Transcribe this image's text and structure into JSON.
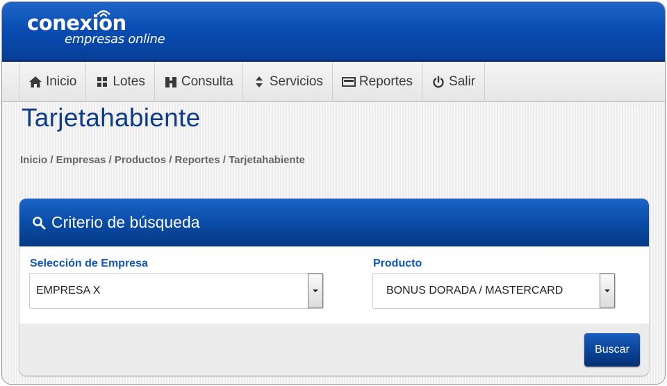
{
  "brand": {
    "name": "conexion",
    "tagline": "empresas online"
  },
  "nav": {
    "items": [
      {
        "label": "Inicio",
        "icon": "home-icon"
      },
      {
        "label": "Lotes",
        "icon": "lotes-icon"
      },
      {
        "label": "Consulta",
        "icon": "consulta-icon"
      },
      {
        "label": "Servicios",
        "icon": "servicios-icon"
      },
      {
        "label": "Reportes",
        "icon": "reportes-icon"
      },
      {
        "label": "Salir",
        "icon": "power-icon"
      }
    ]
  },
  "page": {
    "title": "Tarjetahabiente",
    "breadcrumb": "Inicio / Empresas / Productos / Reportes / Tarjetahabiente"
  },
  "search_panel": {
    "title": "Criterio de búsqueda",
    "icon": "search-icon",
    "empresa": {
      "label": "Selección de Empresa",
      "value": "EMPRESA X"
    },
    "producto": {
      "label": "Producto",
      "value": "BONUS DORADA / MASTERCARD"
    },
    "submit_label": "Buscar"
  },
  "colors": {
    "header_blue": "#0a4db4",
    "title_blue": "#0d3b8c",
    "label_blue": "#0f57b8",
    "button_blue": "#0a4397"
  }
}
